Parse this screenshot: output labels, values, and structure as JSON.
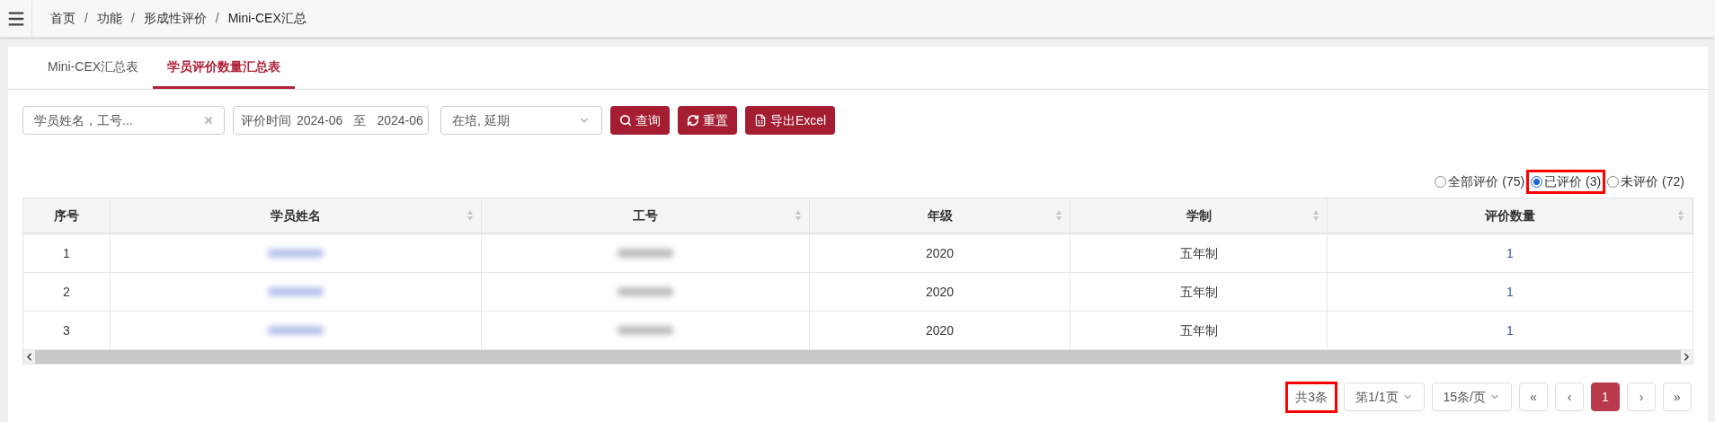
{
  "breadcrumb": [
    {
      "kind": "link",
      "label": "首页"
    },
    {
      "kind": "separator",
      "label": "/"
    },
    {
      "kind": "link",
      "label": "功能"
    },
    {
      "kind": "separator",
      "label": "/"
    },
    {
      "kind": "link",
      "label": "形成性评价"
    },
    {
      "kind": "separator",
      "label": "/"
    },
    {
      "kind": "current",
      "label": "Mini-CEX汇总"
    }
  ],
  "tabs": [
    {
      "label": "Mini-CEX汇总表",
      "selected": false
    },
    {
      "label": "学员评价数量汇总表",
      "selected": true
    }
  ],
  "filters": {
    "search": {
      "placeholder": "学员姓名，工号..."
    },
    "date": {
      "label": "评价时间",
      "from": "2024-06",
      "sep": "至",
      "to": "2024-06"
    },
    "status": {
      "value": "在培, 延期"
    }
  },
  "buttons": [
    {
      "kind": "search",
      "label": "查询"
    },
    {
      "kind": "reset",
      "label": "重置"
    },
    {
      "kind": "excel",
      "label": "导出Excel"
    }
  ],
  "radios": [
    {
      "label": "全部评价 (75)",
      "selected": false,
      "highlighted": false
    },
    {
      "label": "已评价 (3)",
      "selected": true,
      "highlighted": true
    },
    {
      "label": "未评价 (72)",
      "selected": false,
      "highlighted": false
    }
  ],
  "table": {
    "columns": [
      {
        "label": "序号",
        "sortable": false
      },
      {
        "label": "学员姓名",
        "sortable": true
      },
      {
        "label": "工号",
        "sortable": true
      },
      {
        "label": "年级",
        "sortable": true
      },
      {
        "label": "学制",
        "sortable": true
      },
      {
        "label": "评价数量",
        "sortable": true
      }
    ],
    "rows": [
      {
        "index": "1",
        "grade": "2020",
        "system": "五年制",
        "count": "1"
      },
      {
        "index": "2",
        "grade": "2020",
        "system": "五年制",
        "count": "1"
      },
      {
        "index": "3",
        "grade": "2020",
        "system": "五年制",
        "count": "1"
      }
    ]
  },
  "pagination": {
    "total": "共3条",
    "page": "第1/1页",
    "per_page": "15条/页",
    "first": "«",
    "prev": "‹",
    "pages": [
      {
        "label": "1",
        "selected": true
      }
    ],
    "next": "›",
    "last": "»"
  }
}
